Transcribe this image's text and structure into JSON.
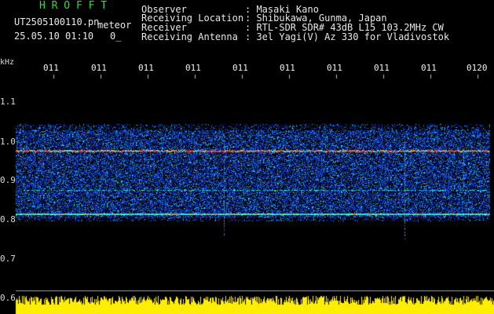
{
  "header": {
    "software": "H R O F F T",
    "filename": "UT2505100110.pn",
    "mode": "meteor",
    "datetime": "25.05.10 01:10",
    "extra": "0_",
    "fields": [
      {
        "label": "Observer",
        "value": ": Masaki Kano"
      },
      {
        "label": "Receiving Location",
        "value": ": Shibukawa, Gunma, Japan"
      },
      {
        "label": "Receiver",
        "value": ": RTL-SDR SDR# 43dB L15 103.2MHz CW"
      },
      {
        "label": "Receiving Antenna",
        "value": ": 3el Yagi(V) Az 330 for Vladivostok"
      }
    ]
  },
  "time_axis": {
    "labels": [
      "011",
      "011",
      "011",
      "011",
      "011",
      "011",
      "011",
      "011",
      "011",
      "0120"
    ]
  },
  "freq_axis": {
    "unit": "kHz",
    "labels": [
      "1.1",
      "1.0",
      "0.9",
      "0.8",
      "0.7",
      "0.6"
    ]
  },
  "colors": {
    "header_green": "#33dd33",
    "signal_bar": "#ffee00",
    "noise_blue": "#1a5cff",
    "carrier": "#ff3030"
  }
}
